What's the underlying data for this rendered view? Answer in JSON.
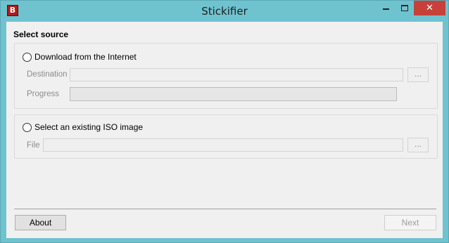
{
  "window": {
    "title": "Stickifier",
    "app_icon_glyph": "B",
    "close_glyph": "✕"
  },
  "source": {
    "heading": "Select source",
    "download": {
      "option_label": "Download from the Internet",
      "selected": false,
      "destination_label": "Destination",
      "destination_value": "",
      "browse_label": "...",
      "progress_label": "Progress",
      "progress_value": 0
    },
    "iso": {
      "option_label": "Select an existing ISO image",
      "selected": false,
      "file_label": "File",
      "file_value": "",
      "browse_label": "..."
    }
  },
  "footer": {
    "about_label": "About",
    "next_label": "Next",
    "next_enabled": false
  },
  "colors": {
    "titlebar": "#6fc3cf",
    "close_button": "#c7413a",
    "progress_fill": "#06b025"
  }
}
